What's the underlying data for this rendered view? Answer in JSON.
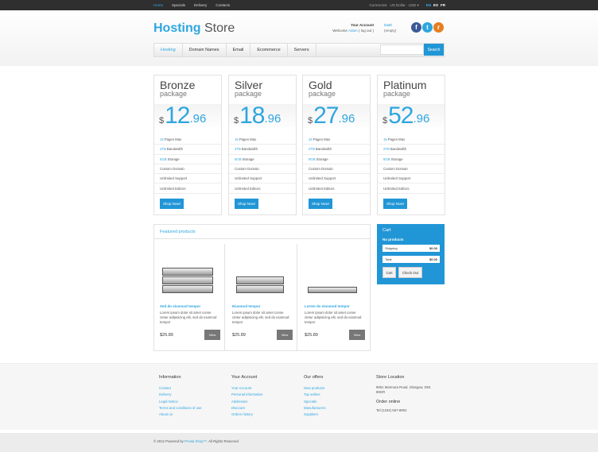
{
  "topbar": {
    "nav": [
      "Home",
      "Specials",
      "Delivery",
      "Contacts"
    ],
    "currencies_label": "Currencies:",
    "currency_selected": "US Dollar · USD ▾",
    "languages": [
      "EN",
      "ES",
      "FR"
    ]
  },
  "header": {
    "logo_bold": "Hosting",
    "logo_rest": " Store",
    "account_title": "Your Account",
    "welcome_text": "Welcome",
    "user_name": "Adam",
    "logout": "( log out )",
    "cart_title": "Cart:",
    "cart_status": "(empty)"
  },
  "social": {
    "facebook": "f",
    "twitter": "t",
    "rss": "r"
  },
  "menu": {
    "items": [
      "Hosting",
      "Domain Names",
      "Email",
      "Ecommerce",
      "Servers"
    ],
    "search_button": "Search"
  },
  "packages": [
    {
      "name": "Bronze",
      "sub": "package",
      "currency": "$",
      "int": "12",
      "dec": ".96",
      "features": [
        [
          "15",
          "Pages Max"
        ],
        [
          "2TB",
          "Bandwidth"
        ],
        [
          "5GB",
          "Storage"
        ],
        [
          "",
          "Custom Domain"
        ],
        [
          "",
          "Unlimited Support"
        ],
        [
          "",
          "Unlimited Editors"
        ]
      ],
      "button": "Shop Now!"
    },
    {
      "name": "Silver",
      "sub": "package",
      "currency": "$",
      "int": "18",
      "dec": ".96",
      "features": [
        [
          "15",
          "Pages Max"
        ],
        [
          "2TB",
          "Bandwidth"
        ],
        [
          "5GB",
          "Storage"
        ],
        [
          "",
          "Custom Domain"
        ],
        [
          "",
          "Unlimited Support"
        ],
        [
          "",
          "Unlimited Editors"
        ]
      ],
      "button": "Shop Now!"
    },
    {
      "name": "Gold",
      "sub": "package",
      "currency": "$",
      "int": "27",
      "dec": ".96",
      "features": [
        [
          "15",
          "Pages Max"
        ],
        [
          "2TB",
          "Bandwidth"
        ],
        [
          "5GB",
          "Storage"
        ],
        [
          "",
          "Custom Domain"
        ],
        [
          "",
          "Unlimited Support"
        ],
        [
          "",
          "Unlimited Editors"
        ]
      ],
      "button": "Shop Now!"
    },
    {
      "name": "Platinum",
      "sub": "package",
      "currency": "$",
      "int": "52",
      "dec": ".96",
      "features": [
        [
          "15",
          "Pages Max"
        ],
        [
          "2TB",
          "Bandwidth"
        ],
        [
          "5GB",
          "Storage"
        ],
        [
          "",
          "Custom Domain"
        ],
        [
          "",
          "Unlimited Support"
        ],
        [
          "",
          "Unlimited Editors"
        ]
      ],
      "button": "Shop Now!"
    }
  ],
  "featured": {
    "title": "Featured products",
    "products": [
      {
        "name": "Sed do eiusmod tempor",
        "desc": "Lorem ipsum dolor sit amet conse ctetur adipisicing elit, sed do eiusmod tempor",
        "price": "$25.89",
        "button": "View",
        "units": 3
      },
      {
        "name": "Eiusmod tempor",
        "desc": "Lorem ipsum dolor sit amet conse ctetur adipisicing elit, sed do eiusmod tempor",
        "price": "$25.89",
        "button": "View",
        "units": 2
      },
      {
        "name": "Lorem do eiusmod tempor",
        "desc": "Lorem ipsum dolor sit amet conse ctetur adipisicing elit, sed do eiusmod tempor",
        "price": "$25.89",
        "button": "View",
        "units": 1
      }
    ]
  },
  "cart": {
    "title": "Cart",
    "empty_text": "No products",
    "shipping_label": "Shipping",
    "shipping_value": "$0.00",
    "total_label": "Total",
    "total_value": "$0.00",
    "cart_button": "Cart",
    "checkout_button": "Check Out"
  },
  "footer": {
    "information": {
      "title": "Information",
      "links": [
        "Contact",
        "Delivery",
        "Legal Notice",
        "Terms and conditions of use",
        "About us"
      ]
    },
    "account": {
      "title": "Your Account",
      "links": [
        "Your Account",
        "Personal information",
        "Addresses",
        "Discount",
        "Orders history"
      ]
    },
    "offers": {
      "title": "Our offers",
      "links": [
        "New products",
        "Top sellers",
        "Specials",
        "Manufacturers",
        "Suppliers"
      ]
    },
    "store": {
      "title": "Store Location",
      "address": "9061 Marmora Road, Glasgow, D04 89GR",
      "order_title": "Order online",
      "phone": "Tel:(1234) 567-8902"
    }
  },
  "copyright": {
    "prefix": "© 2012 Powered by",
    "brand": "Presta Shop™",
    "suffix": ". All Rights Reserved"
  },
  "colors": {
    "accent": "#2ea6e0",
    "button": "#2196d6",
    "topbar": "#2f2f2f"
  }
}
